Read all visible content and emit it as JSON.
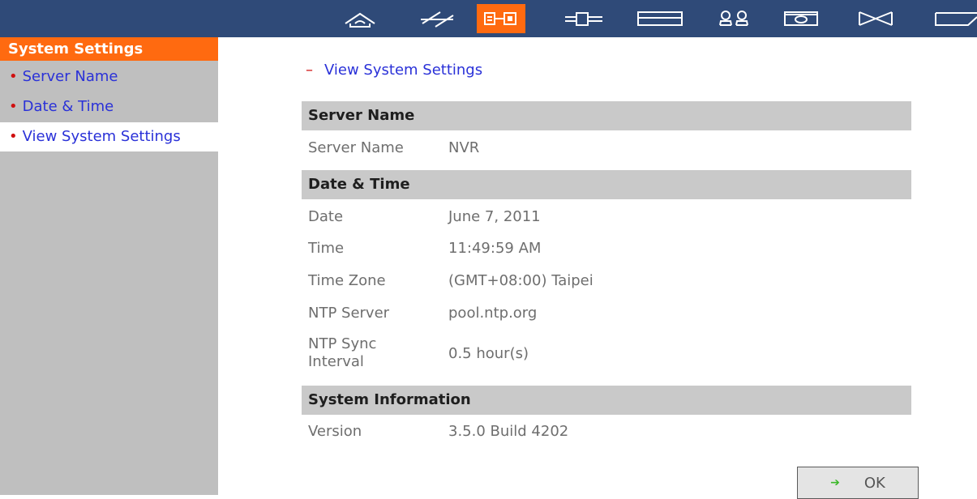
{
  "toolbar": {
    "icons": [
      "home-icon",
      "quick-config-icon",
      "system-settings-icon",
      "network-icon",
      "device-config-icon",
      "user-management-icon",
      "camera-settings-icon",
      "system-tools-icon",
      "event-logs-icon"
    ],
    "active": "system-settings-icon"
  },
  "sidebar": {
    "header": "System Settings",
    "items": [
      {
        "label": "Server Name"
      },
      {
        "label": "Date & Time"
      },
      {
        "label": "View System Settings"
      }
    ]
  },
  "content": {
    "breadcrumb_marker": "–",
    "breadcrumb": "View System Settings",
    "sections": {
      "server": {
        "title": "Server Name",
        "rows": [
          {
            "label": "Server Name",
            "value": "NVR"
          }
        ]
      },
      "datetime": {
        "title": "Date & Time",
        "rows": [
          {
            "label": "Date",
            "value": "June 7, 2011"
          },
          {
            "label": "Time",
            "value": "11:49:59 AM"
          },
          {
            "label": "Time Zone",
            "value": "(GMT+08:00) Taipei"
          },
          {
            "label": "NTP Server",
            "value": "pool.ntp.org"
          },
          {
            "label_line1": "NTP Sync",
            "label_line2": "Interval",
            "value": "0.5 hour(s)"
          }
        ]
      },
      "sysinfo": {
        "title": "System Information",
        "rows": [
          {
            "label": "Version",
            "value": "3.5.0 Build 4202"
          }
        ]
      }
    },
    "ok_label": "OK"
  },
  "colors": {
    "toolbar_bg": "#2f4a78",
    "accent": "#ff6a10",
    "sidebar_bg": "#bfbfbf",
    "link": "#2a31d8",
    "section_header_bg": "#c9c9c9"
  }
}
